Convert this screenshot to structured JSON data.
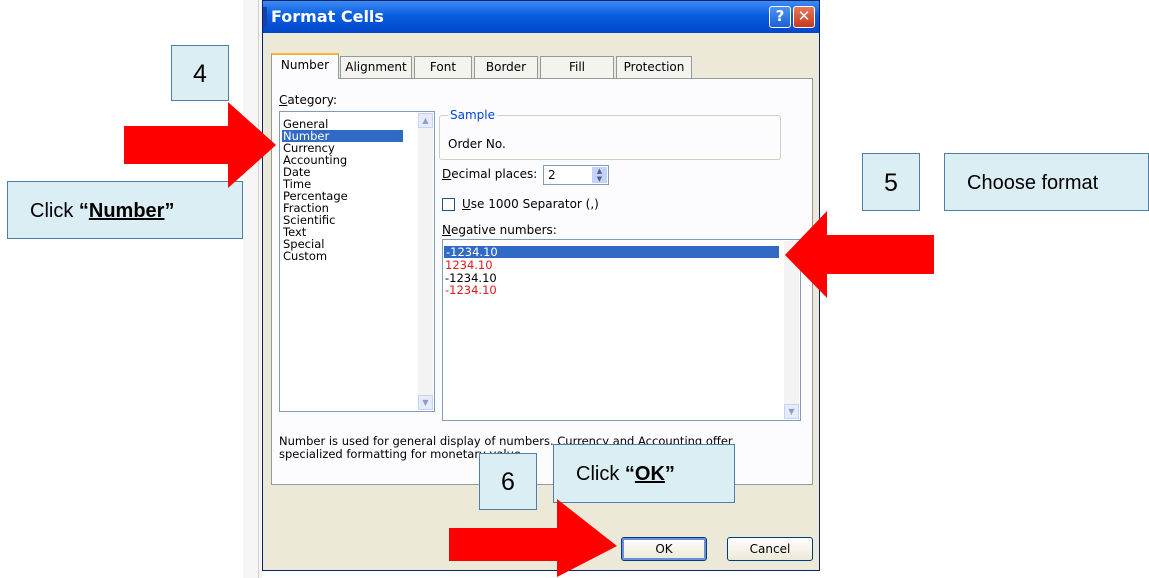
{
  "dialog": {
    "title": "Format Cells",
    "help_glyph": "?",
    "close_glyph": "✕",
    "tabs": [
      {
        "label": "Number"
      },
      {
        "label": "Alignment"
      },
      {
        "label": "Font"
      },
      {
        "label": "Border"
      },
      {
        "label": "Fill"
      },
      {
        "label": "Protection"
      }
    ],
    "active_tab": "Number",
    "category_label": "Category:",
    "categories": [
      "General",
      "Number",
      "Currency",
      "Accounting",
      "Date",
      "Time",
      "Percentage",
      "Fraction",
      "Scientific",
      "Text",
      "Special",
      "Custom"
    ],
    "selected_category": "Number",
    "sample": {
      "group_label": "Sample",
      "value": "Order No."
    },
    "decimal_places": {
      "label": "Decimal places:",
      "value": "2"
    },
    "separator": {
      "label": "Use 1000 Separator (,)",
      "checked": false
    },
    "negative_numbers": {
      "label": "Negative numbers:",
      "items": [
        {
          "text": "-1234.10",
          "color": "#000000",
          "selected": true
        },
        {
          "text": "1234.10",
          "color": "#e0191c",
          "selected": false
        },
        {
          "text": "-1234.10",
          "color": "#000000",
          "selected": false
        },
        {
          "text": "-1234.10",
          "color": "#e0191c",
          "selected": false
        }
      ]
    },
    "description": "Number is used for general display of numbers.  Currency and Accounting offer specialized formatting for monetary value.",
    "ok_label": "OK",
    "cancel_label": "Cancel"
  },
  "annotations": {
    "step4": {
      "number": "4",
      "prefix": "Click ",
      "target": "“Number”"
    },
    "step5": {
      "number": "5",
      "text": "Choose format"
    },
    "step6": {
      "number": "6",
      "prefix": "Click ",
      "target": "“OK”"
    },
    "arrow_color": "#ff0000"
  }
}
